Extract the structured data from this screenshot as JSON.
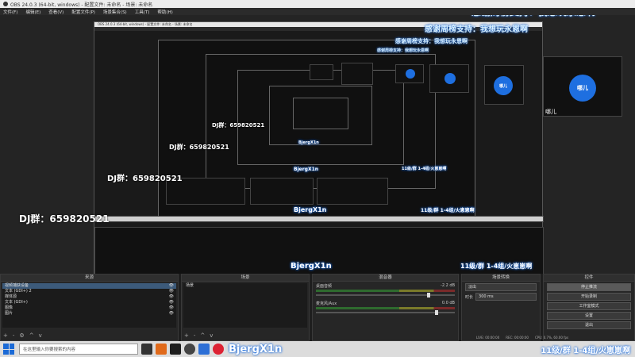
{
  "window": {
    "title": "OBS 24.0.3 (64-bit, windows) - 配置文件: 未命名 - 场景: 未命名"
  },
  "menu": {
    "items": [
      "文件(F)",
      "编辑(E)",
      "查看(V)",
      "配置文件(P)",
      "场景集合(S)",
      "工具(T)",
      "帮助(H)"
    ]
  },
  "overlay": {
    "thanks": "感谢周榜支持：我想玩永恩啊",
    "dj_group": "DJ群：659820521",
    "bubble_label": "哪儿",
    "streamer": "BjergX1n",
    "rank": "11级/群 1-4组/火崽崽啊"
  },
  "docks": {
    "sources": {
      "title": "来源",
      "items": [
        "视频捕获设备",
        "文本 (GDI+) 2",
        "媒体源",
        "文本 (GDI+)",
        "图像",
        "图片"
      ],
      "controls": [
        "+",
        "-",
        "⚙",
        "^",
        "v"
      ]
    },
    "scenes": {
      "title": "场景",
      "items": [
        "场景"
      ],
      "controls": [
        "+",
        "-",
        "^",
        "v"
      ]
    },
    "mixer": {
      "title": "混音器",
      "tracks": [
        {
          "label": "桌面音频",
          "db": "-2.2 dB"
        },
        {
          "label": "麦克风/Aux",
          "db": "0.0 dB"
        }
      ]
    },
    "transitions": {
      "title": "场景转换",
      "type": "淡出",
      "duration_label": "时长",
      "duration_value": "300 ms"
    },
    "controls": {
      "title": "控件",
      "buttons": [
        "停止推流",
        "开始录制",
        "工作室模式",
        "设置",
        "退出"
      ]
    }
  },
  "status": {
    "live": "LIVE: 00:00:00",
    "rec": "REC: 00:00:00",
    "cpu": "CPU: 0.7%, 60.00 fps"
  },
  "taskbar": {
    "search_placeholder": "在这里输入你要搜索的内容"
  },
  "colors": {
    "accent": "#1e6fe0",
    "menu_bg": "#2b2b2b",
    "panel_bg": "#262626"
  }
}
